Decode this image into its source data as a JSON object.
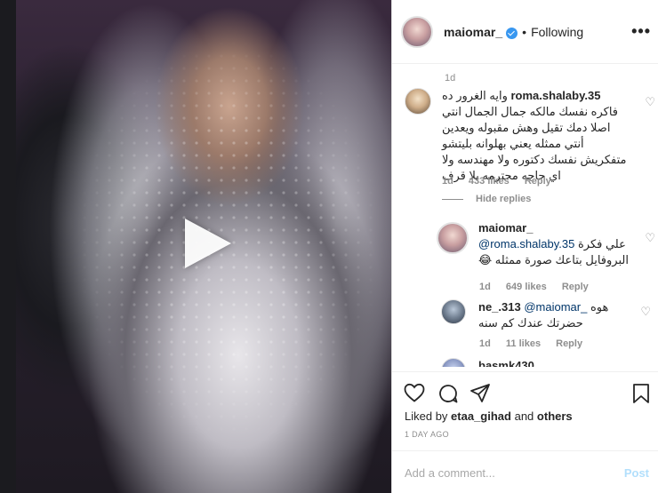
{
  "header": {
    "username": "maiomar_",
    "separator": "•",
    "follow_status": "Following",
    "more": "•••"
  },
  "post": {
    "media_type": "video",
    "play_icon": "play-icon"
  },
  "comments": {
    "top_timestamp": "1d",
    "items": [
      {
        "username": "roma.shalaby.35",
        "text": "وايه الغرور ده فاكره نفسك مالكه جمال الجمال انتي اصلا دمك تقيل وهش مقبوله ويعدين أنتي ممثله يعني بهلوانه بليتشو متفكريش نفسك دكتوره ولا مهندسه ولا اي حاجه محترمه بلا قرف",
        "time": "1d",
        "likes": "433 likes",
        "reply": "Reply"
      }
    ],
    "hide_replies": "Hide replies",
    "replies": [
      {
        "username": "maiomar_",
        "mention": "@roma.shalaby.35",
        "text": "علي فكرة",
        "line2": "البروفايل بتاعك صورة ممثله 😂",
        "time": "1d",
        "likes": "649 likes",
        "reply": "Reply"
      },
      {
        "username": "ne_.313",
        "mention": "@maiomar_",
        "text": "هوه",
        "line2": "حضرتك عندك كم سنه",
        "time": "1d",
        "likes": "11 likes",
        "reply": "Reply"
      },
      {
        "username": "basmk430"
      }
    ]
  },
  "footer": {
    "liked_by_prefix": "Liked by",
    "liked_by_user": "etaa_gihad",
    "liked_by_and": "and",
    "liked_by_others": "others",
    "date": "1 DAY AGO",
    "add_comment_placeholder": "Add a comment...",
    "post_label": "Post"
  },
  "colors": {
    "verified": "#3897f0",
    "post_disabled": "#b2dffc",
    "meta": "#8e8e8e"
  }
}
